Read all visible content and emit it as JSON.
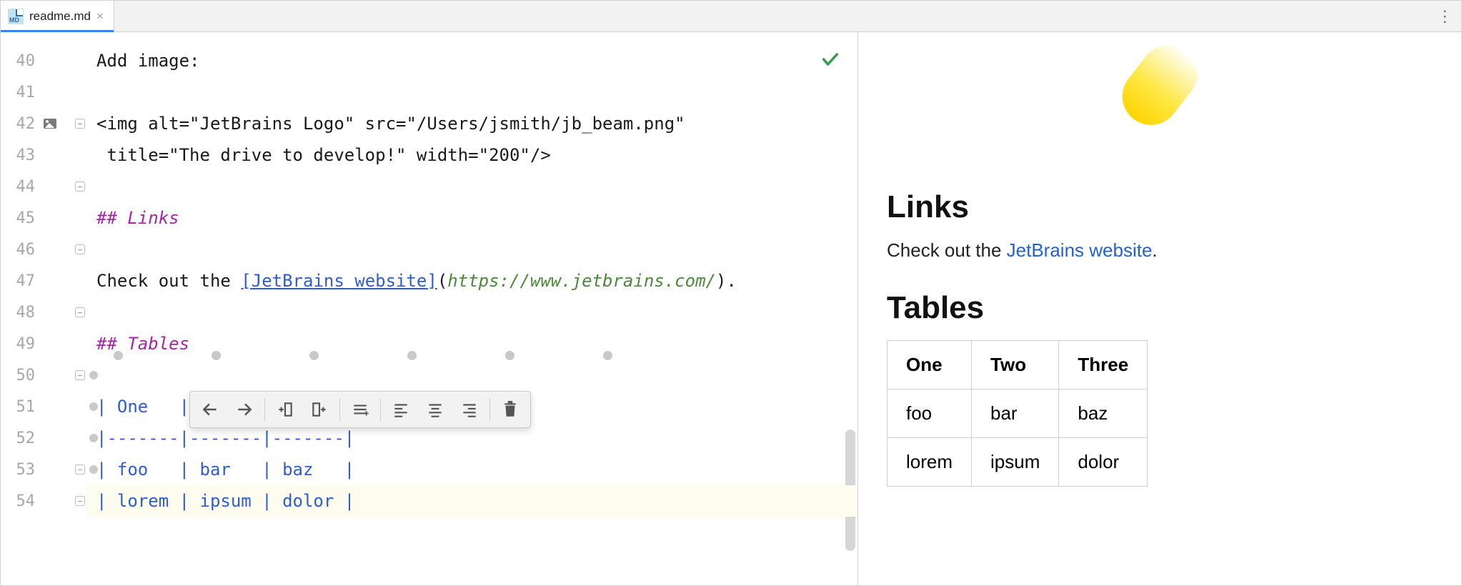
{
  "tab": {
    "filename": "readme.md"
  },
  "gutter": {
    "lines": [
      40,
      41,
      42,
      43,
      44,
      45,
      46,
      47,
      48,
      49,
      50,
      51,
      52,
      53,
      54
    ]
  },
  "code": {
    "l40": "Add image:",
    "l42a": "<img alt=\"JetBrains Logo\" src=\"/Users/jsmith/jb_beam.png\"",
    "l42b": " title=\"The drive to develop!\" width=\"200\"/>",
    "l44_prefix": "## ",
    "l44_title": "Links",
    "l46_pre": "Check out the ",
    "l46_link": "[JetBrains website]",
    "l46_paren_open": "(",
    "l46_url": "https://www.jetbrains.com/",
    "l46_paren_close": ")",
    "l46_dot": ".",
    "l48_prefix": "## ",
    "l48_title": "Tables",
    "l50": "| One   | Two   | Three |",
    "l51": "|-------|-------|-------|",
    "l52": "| foo   | bar   | baz   |",
    "l53": "| lorem | ipsum | dolor |"
  },
  "preview": {
    "links_h": "Links",
    "links_text_pre": "Check out the ",
    "links_text_link": "JetBrains website",
    "links_text_post": ".",
    "tables_h": "Tables",
    "table": {
      "headers": [
        "One",
        "Two",
        "Three"
      ],
      "rows": [
        [
          "foo",
          "bar",
          "baz"
        ],
        [
          "lorem",
          "ipsum",
          "dolor"
        ]
      ]
    }
  },
  "toolbar": {
    "items": [
      "nav-back",
      "nav-forward",
      "|",
      "insert-col-left",
      "insert-col-right",
      "|",
      "select-cells",
      "|",
      "align-left",
      "align-center",
      "align-right",
      "|",
      "delete"
    ]
  }
}
